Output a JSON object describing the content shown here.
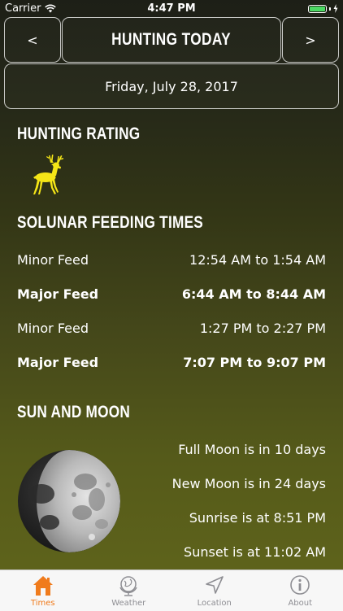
{
  "status_bar": {
    "carrier": "Carrier",
    "time": "4:47 PM"
  },
  "header": {
    "prev_label": "<",
    "title": "HUNTING TODAY",
    "next_label": ">",
    "date": "Friday, July 28, 2017"
  },
  "hunting_rating": {
    "title": "HUNTING RATING",
    "icon": "deer-icon",
    "color": "#f5e617"
  },
  "solunar": {
    "title": "SOLUNAR FEEDING TIMES",
    "rows": [
      {
        "label": "Minor Feed",
        "time": "12:54 AM to 1:54 AM"
      },
      {
        "label": "Major Feed",
        "time": "6:44 AM to 8:44 AM"
      },
      {
        "label": "Minor Feed",
        "time": "1:27 PM to 2:27 PM"
      },
      {
        "label": "Major Feed",
        "time": "7:07 PM to 9:07 PM"
      }
    ]
  },
  "sun_moon": {
    "title": "SUN AND MOON",
    "lines": [
      "Full Moon is in 10 days",
      "New Moon is in 24 days",
      "Sunrise is at 8:51 PM",
      "Sunset is at 11:02 AM"
    ]
  },
  "tabs": [
    {
      "label": "Times",
      "icon": "home-icon",
      "active": true
    },
    {
      "label": "Weather",
      "icon": "globe-icon",
      "active": false
    },
    {
      "label": "Location",
      "icon": "location-arrow-icon",
      "active": false
    },
    {
      "label": "About",
      "icon": "info-icon",
      "active": false
    }
  ],
  "colors": {
    "accent": "#f07b1c",
    "battery": "#4cd964",
    "tab_inactive": "#8e8e93"
  }
}
